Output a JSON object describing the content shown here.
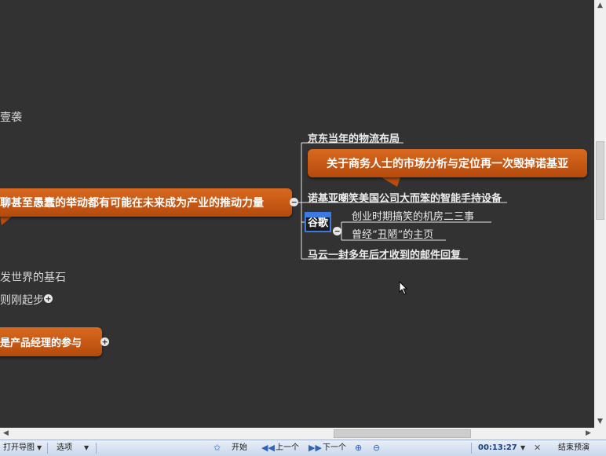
{
  "mindmap": {
    "left_text_1": "壹袭",
    "left_bubble_main": "聊甚至愚蠢的举动都有可能在未来成为产业的推动力量",
    "left_text_2": "发世界的基石",
    "left_text_3": "则刚起步",
    "left_bubble_bottom": "是产品经理的参与",
    "jd_logistics": "京东当年的物流布局",
    "callout": "关于商务人士的市场分析与定位再一次毁掉诺基亚",
    "nokia": "诺基亚嘲笑美国公司大而笨的智能手持设备",
    "google": "谷歌",
    "google_child_1": "创业时期搞笑的机房二三事",
    "google_child_2": "曾经“丑陋”的主页",
    "jack_ma": "马云一封多年后才收到的邮件回复"
  },
  "toolbar": {
    "open_map": "打开导图",
    "options": "选项",
    "start": "开始",
    "prev": "上一个",
    "next": "下一个",
    "timer": "00:13:27",
    "end": "结束预演"
  },
  "colors": {
    "background": "#323232",
    "bubble_orange": "#c8561a",
    "line": "#e6e6e6",
    "selection_blue": "#3b7ae0"
  }
}
